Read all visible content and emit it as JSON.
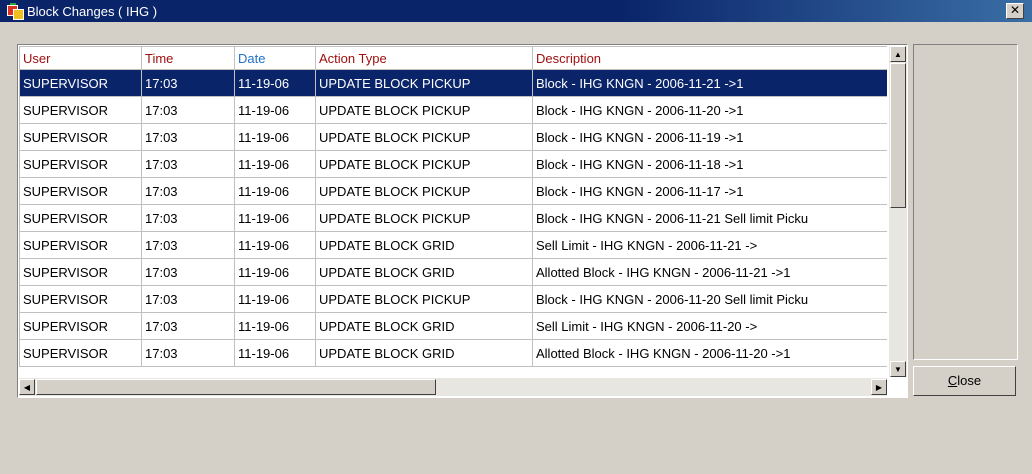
{
  "window": {
    "title": "Block Changes ( IHG )",
    "close_glyph": "✕"
  },
  "columns": [
    {
      "label": "User",
      "color": "#a01010"
    },
    {
      "label": "Time",
      "color": "#a01010"
    },
    {
      "label": "Date",
      "color": "#1f6fc8"
    },
    {
      "label": "Action Type",
      "color": "#a01010"
    },
    {
      "label": "Description",
      "color": "#a01010"
    }
  ],
  "rows": [
    [
      "SUPERVISOR",
      "17:03",
      "11-19-06",
      "UPDATE BLOCK PICKUP",
      "Block - IHG  KNGN - 2006-11-21  ->1"
    ],
    [
      "SUPERVISOR",
      "17:03",
      "11-19-06",
      "UPDATE BLOCK PICKUP",
      "Block - IHG  KNGN - 2006-11-20  ->1"
    ],
    [
      "SUPERVISOR",
      "17:03",
      "11-19-06",
      "UPDATE BLOCK PICKUP",
      "Block - IHG  KNGN - 2006-11-19  ->1"
    ],
    [
      "SUPERVISOR",
      "17:03",
      "11-19-06",
      "UPDATE BLOCK PICKUP",
      "Block - IHG  KNGN - 2006-11-18  ->1"
    ],
    [
      "SUPERVISOR",
      "17:03",
      "11-19-06",
      "UPDATE BLOCK PICKUP",
      "Block - IHG  KNGN - 2006-11-17  ->1"
    ],
    [
      "SUPERVISOR",
      "17:03",
      "11-19-06",
      "UPDATE BLOCK PICKUP",
      "Block - IHG  KNGN - 2006-11-21   Sell limit Picku"
    ],
    [
      "SUPERVISOR",
      "17:03",
      "11-19-06",
      "UPDATE BLOCK GRID",
      "Sell Limit - IHG  KNGN - 2006-11-21  ->"
    ],
    [
      "SUPERVISOR",
      "17:03",
      "11-19-06",
      "UPDATE BLOCK GRID",
      "Allotted Block - IHG  KNGN - 2006-11-21  ->1"
    ],
    [
      "SUPERVISOR",
      "17:03",
      "11-19-06",
      "UPDATE BLOCK PICKUP",
      "Block - IHG  KNGN - 2006-11-20   Sell limit Picku"
    ],
    [
      "SUPERVISOR",
      "17:03",
      "11-19-06",
      "UPDATE BLOCK GRID",
      "Sell Limit - IHG  KNGN - 2006-11-20  ->"
    ],
    [
      "SUPERVISOR",
      "17:03",
      "11-19-06",
      "UPDATE BLOCK GRID",
      "Allotted Block - IHG  KNGN - 2006-11-20  ->1"
    ]
  ],
  "selected_row": 0,
  "buttons": {
    "close_label": "Close",
    "close_mnemonic": "C",
    "close_rest": "lose"
  },
  "colors": {
    "title_bar": "#0a246a",
    "selection": "#0a246a",
    "window_bg": "#d4d0c8"
  }
}
